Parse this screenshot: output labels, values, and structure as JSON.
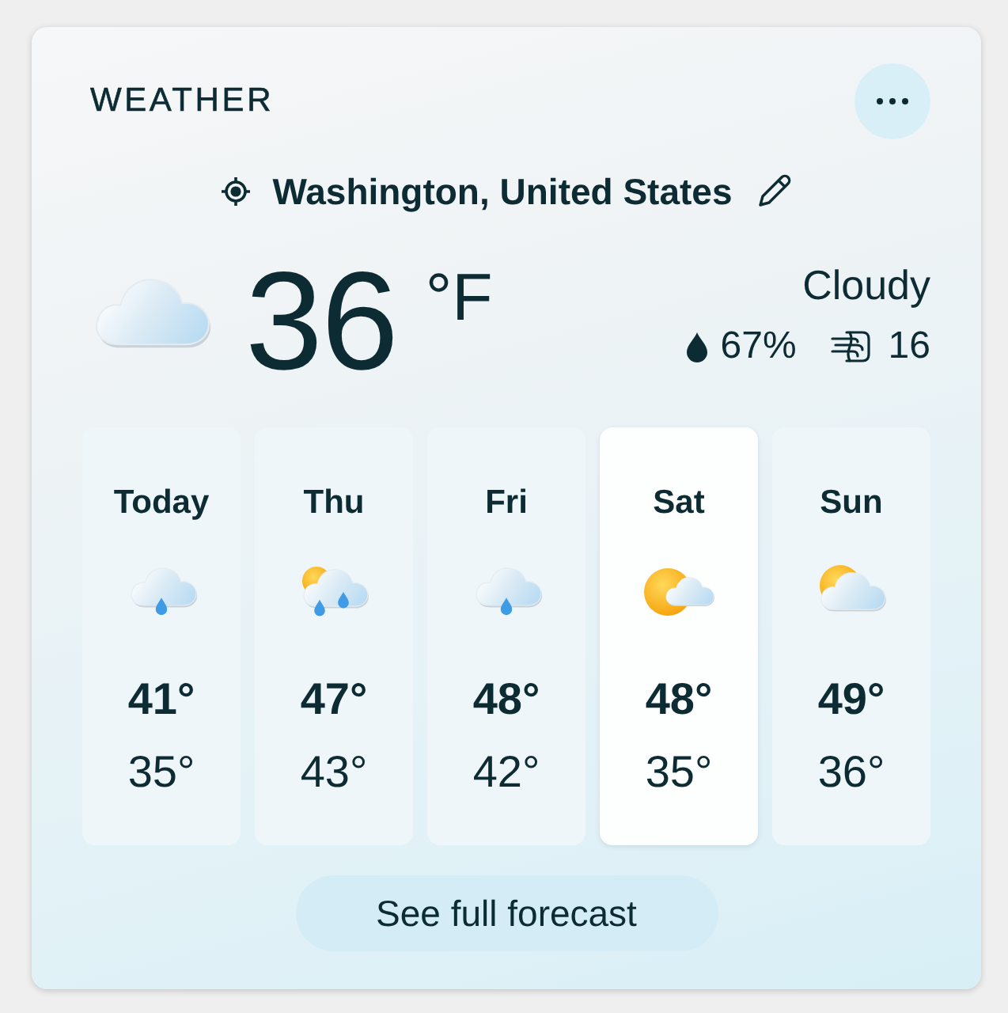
{
  "header": {
    "title": "WEATHER"
  },
  "location": {
    "name": "Washington, United States"
  },
  "current": {
    "kind": "cloudy",
    "temperature": "36",
    "unit": "°F",
    "condition": "Cloudy",
    "humidity": "67%",
    "wind": "16"
  },
  "forecast": [
    {
      "day": "Today",
      "kind": "rain",
      "high": "41°",
      "low": "35°",
      "selected": false
    },
    {
      "day": "Thu",
      "kind": "sun_rain",
      "high": "47°",
      "low": "43°",
      "selected": false
    },
    {
      "day": "Fri",
      "kind": "rain",
      "high": "48°",
      "low": "42°",
      "selected": false
    },
    {
      "day": "Sat",
      "kind": "partly_sunny",
      "high": "48°",
      "low": "35°",
      "selected": true
    },
    {
      "day": "Sun",
      "kind": "mostly_cloudy",
      "high": "49°",
      "low": "36°",
      "selected": false
    }
  ],
  "footer": {
    "button": "See full forecast"
  }
}
